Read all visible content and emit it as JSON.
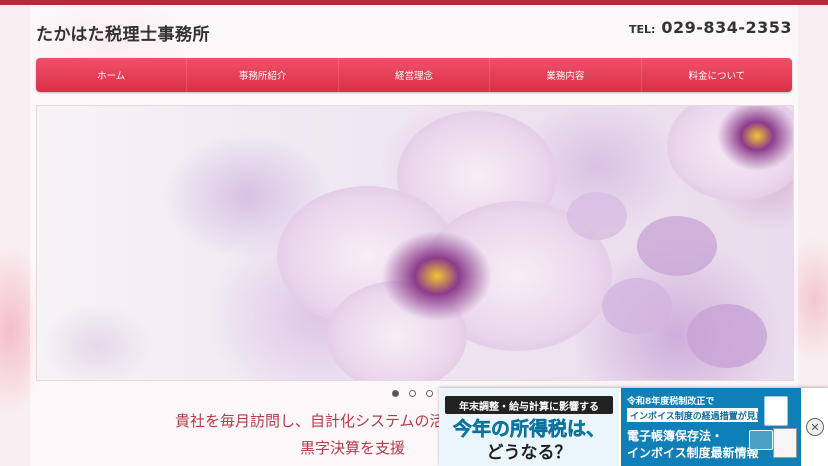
{
  "header": {
    "site_title": "たかはた税理士事務所",
    "tel_label": "TEL:",
    "tel_number": "029-834-2353"
  },
  "nav": {
    "items": [
      {
        "label": "ホーム"
      },
      {
        "label": "事務所紹介"
      },
      {
        "label": "経営理念"
      },
      {
        "label": "業務内容"
      },
      {
        "label": "料金について"
      }
    ]
  },
  "slider": {
    "dot_count": 3,
    "active_index": 0
  },
  "tagline": {
    "line1": "貴社を毎月訪問し、自計化システムの活",
    "line2": "黒字決算を支援"
  },
  "ad": {
    "left": {
      "line1": "年末調整・給与計算に影響する",
      "line2": "今年の所得税は、",
      "line3": "どうなる？"
    },
    "right": {
      "line1": "令和8年度税制改正で",
      "line2": "インボイス制度の経過措置が見直し",
      "line3": "電子帳簿保存法・",
      "line4": "インボイス制度最新情報"
    },
    "close_symbol": "✕"
  },
  "colors": {
    "accent": "#dc2f48",
    "top_bar": "#b52a38",
    "tagline": "#b43c47",
    "ad_blue": "#0f7fb7"
  }
}
